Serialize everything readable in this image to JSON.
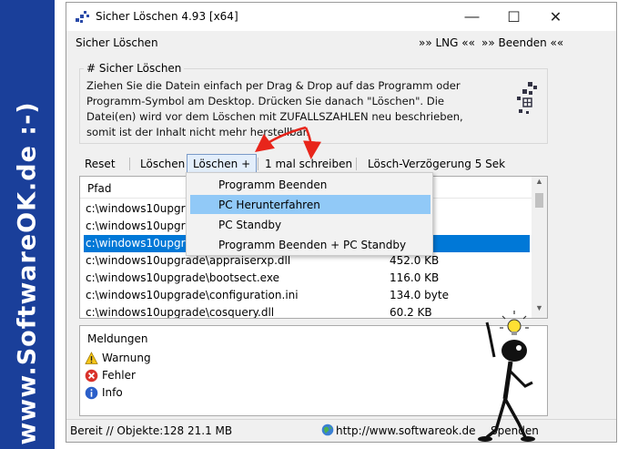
{
  "watermark": {
    "text": "www.SoftwareOK.de :-)"
  },
  "window": {
    "title": "Sicher Löschen 4.93 [x64]",
    "controls": {
      "minimize": "—",
      "maximize": "☐",
      "close": "✕"
    }
  },
  "menu": {
    "left": "Sicher Löschen",
    "lng": "»» LNG ««",
    "quit": "»» Beenden ««"
  },
  "info": {
    "title": "# Sicher Löschen",
    "text": "Ziehen Sie die Datein einfach per Drag & Drop auf das Programm oder Programm-Symbol am Desktop. Drücken Sie danach \"Löschen\". Die Datei(en) wird vor dem Löschen mit ZUFALLSZAHLEN neu beschrieben, somit ist der Inhalt nicht mehr herstellbar."
  },
  "toolbar": {
    "reset": "Reset",
    "delete": "Löschen",
    "delete_plus": "Löschen +",
    "write_once": "1 mal schreiben",
    "delay": "Lösch-Verzögerung 5 Sek"
  },
  "list": {
    "header_path": "Pfad",
    "rows": [
      {
        "path": "c:\\windows10upgrade",
        "size": ""
      },
      {
        "path": "c:\\windows10upgrade",
        "size": ""
      },
      {
        "path": "c:\\windows10upgrade",
        "size": ""
      },
      {
        "path": "c:\\windows10upgrade\\appraiserxp.dll",
        "size": "452.0 KB"
      },
      {
        "path": "c:\\windows10upgrade\\bootsect.exe",
        "size": "116.0 KB"
      },
      {
        "path": "c:\\windows10upgrade\\configuration.ini",
        "size": "134.0 byte"
      },
      {
        "path": "c:\\windows10upgrade\\cosquery.dll",
        "size": "60.2 KB"
      }
    ]
  },
  "dropdown": {
    "items": [
      "Programm Beenden",
      "PC Herunterfahren",
      "PC Standby",
      "Programm Beenden + PC Standby"
    ]
  },
  "messages": {
    "title": "Meldungen",
    "warning": "Warnung",
    "error": "Fehler",
    "info": "Info"
  },
  "status": {
    "left": "Bereit // Objekte:128 21.1 MB",
    "url": "http://www.softwareok.de",
    "donate": "Spenden"
  },
  "colors": {
    "selection": "#0078d7",
    "dropdown_highlight": "#91c9f7",
    "annotation_arrow": "#e8251b",
    "watermark": "#1a3f9a"
  }
}
